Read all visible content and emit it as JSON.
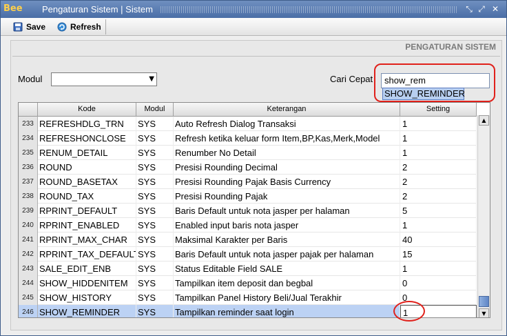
{
  "window": {
    "logo": "Bee",
    "title": "Pengaturan Sistem | Sistem"
  },
  "toolbar": {
    "save_label": "Save",
    "refresh_label": "Refresh"
  },
  "page": {
    "section_title": "PENGATURAN SISTEM",
    "modul_label": "Modul",
    "modul_value": "",
    "search_label": "Cari Cepat",
    "search_value": "show_rem",
    "suggestion": "SHOW_REMINDER"
  },
  "table": {
    "headers": [
      "Kode",
      "Modul",
      "Keterangan",
      "Setting"
    ],
    "rows": [
      {
        "no": "233",
        "kode": "REFRESHDLG_TRN",
        "modul": "SYS",
        "ket": "Auto Refresh Dialog Transaksi",
        "set": "1"
      },
      {
        "no": "234",
        "kode": "REFRESHONCLOSE",
        "modul": "SYS",
        "ket": "Refresh ketika keluar form Item,BP,Kas,Merk,Model",
        "set": "1"
      },
      {
        "no": "235",
        "kode": "RENUM_DETAIL",
        "modul": "SYS",
        "ket": "Renumber No Detail",
        "set": "1"
      },
      {
        "no": "236",
        "kode": "ROUND",
        "modul": "SYS",
        "ket": "Presisi Rounding Decimal",
        "set": "2"
      },
      {
        "no": "237",
        "kode": "ROUND_BASETAX",
        "modul": "SYS",
        "ket": "Presisi Rounding Pajak Basis Currency",
        "set": "2"
      },
      {
        "no": "238",
        "kode": "ROUND_TAX",
        "modul": "SYS",
        "ket": "Presisi Rounding Pajak",
        "set": "2"
      },
      {
        "no": "239",
        "kode": "RPRINT_DEFAULT",
        "modul": "SYS",
        "ket": "Baris Default untuk nota jasper per halaman",
        "set": "5"
      },
      {
        "no": "240",
        "kode": "RPRINT_ENABLED",
        "modul": "SYS",
        "ket": "Enabled input baris nota jasper",
        "set": "1"
      },
      {
        "no": "241",
        "kode": "RPRINT_MAX_CHAR",
        "modul": "SYS",
        "ket": "Maksimal Karakter per Baris",
        "set": "40"
      },
      {
        "no": "242",
        "kode": "RPRINT_TAX_DEFAULT",
        "modul": "SYS",
        "ket": "Baris Default untuk nota jasper pajak per halaman",
        "set": "15"
      },
      {
        "no": "243",
        "kode": "SALE_EDIT_ENB",
        "modul": "SYS",
        "ket": "Status Editable Field SALE",
        "set": "1"
      },
      {
        "no": "244",
        "kode": "SHOW_HIDDENITEM",
        "modul": "SYS",
        "ket": "Tampilkan item deposit dan begbal",
        "set": "0"
      },
      {
        "no": "245",
        "kode": "SHOW_HISTORY",
        "modul": "SYS",
        "ket": "Tampilkan Panel History Beli/Jual Terakhir",
        "set": "0"
      },
      {
        "no": "246",
        "kode": "SHOW_REMINDER",
        "modul": "SYS",
        "ket": "Tampilkan reminder saat login",
        "set": "1"
      }
    ]
  },
  "colors": {
    "selected_row": "#bcd2f4",
    "annotation": "#e0201a",
    "titlebar": "#4a6ea6"
  }
}
